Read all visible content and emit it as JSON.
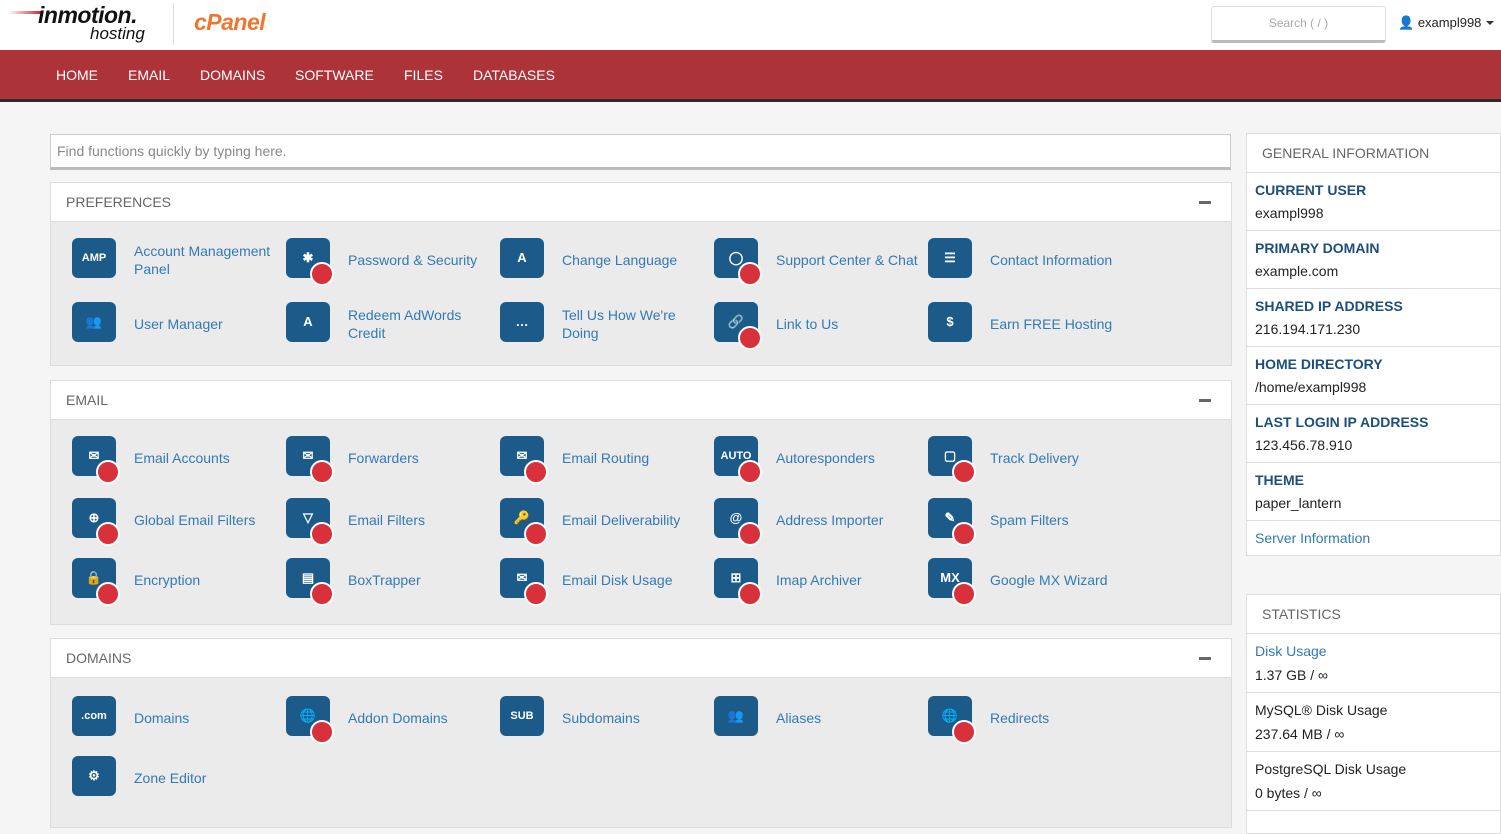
{
  "header": {
    "logo_text": "inmotion hosting",
    "logo_sub": "hosting",
    "product": "cPanel",
    "search_placeholder": "Search ( / )",
    "username": "exampl998"
  },
  "nav": [
    "HOME",
    "EMAIL",
    "DOMAINS",
    "SOFTWARE",
    "FILES",
    "DATABASES"
  ],
  "find_placeholder": "Find functions quickly by typing here.",
  "sections": [
    {
      "title": "PREFERENCES",
      "items": [
        {
          "label": "Account Management Panel",
          "icon": "amp-icon",
          "glyph": "AMP"
        },
        {
          "label": "Password & Security",
          "icon": "shield-password-icon",
          "glyph": "✱"
        },
        {
          "label": "Change Language",
          "icon": "language-icon",
          "glyph": "A"
        },
        {
          "label": "Support Center & Chat",
          "icon": "support-lifebuoy-icon",
          "glyph": "◯"
        },
        {
          "label": "Contact Information",
          "icon": "contact-card-icon",
          "glyph": "☰"
        },
        {
          "label": "User Manager",
          "icon": "user-manager-icon",
          "glyph": "👥"
        },
        {
          "label": "Redeem AdWords Credit",
          "icon": "adwords-icon",
          "glyph": "A"
        },
        {
          "label": "Tell Us How We're Doing",
          "icon": "feedback-icon",
          "glyph": "…"
        },
        {
          "label": "Link to Us",
          "icon": "link-icon",
          "glyph": "🔗"
        },
        {
          "label": "Earn FREE Hosting",
          "icon": "earn-hosting-icon",
          "glyph": "$"
        }
      ]
    },
    {
      "title": "EMAIL",
      "items": [
        {
          "label": "Email Accounts",
          "icon": "email-accounts-icon",
          "glyph": "✉"
        },
        {
          "label": "Forwarders",
          "icon": "forwarders-icon",
          "glyph": "✉"
        },
        {
          "label": "Email Routing",
          "icon": "email-routing-icon",
          "glyph": "✉"
        },
        {
          "label": "Autoresponders",
          "icon": "autoresponders-icon",
          "glyph": "AUTO"
        },
        {
          "label": "Track Delivery",
          "icon": "track-delivery-icon",
          "glyph": "▢"
        },
        {
          "label": "Global Email Filters",
          "icon": "global-filter-icon",
          "glyph": "⊕"
        },
        {
          "label": "Email Filters",
          "icon": "email-filter-icon",
          "glyph": "▽"
        },
        {
          "label": "Email Deliverability",
          "icon": "deliverability-icon",
          "glyph": "🔑"
        },
        {
          "label": "Address Importer",
          "icon": "address-importer-icon",
          "glyph": "@"
        },
        {
          "label": "Spam Filters",
          "icon": "spam-filter-icon",
          "glyph": "✎"
        },
        {
          "label": "Encryption",
          "icon": "encryption-lock-icon",
          "glyph": "🔒"
        },
        {
          "label": "BoxTrapper",
          "icon": "boxtrapper-icon",
          "glyph": "▤"
        },
        {
          "label": "Email Disk Usage",
          "icon": "email-disk-usage-icon",
          "glyph": "✉"
        },
        {
          "label": "Imap Archiver",
          "icon": "imap-archiver-icon",
          "glyph": "⊞"
        },
        {
          "label": "Google MX Wizard",
          "icon": "mx-wizard-icon",
          "glyph": "MX"
        }
      ]
    },
    {
      "title": "DOMAINS",
      "items": [
        {
          "label": "Domains",
          "icon": "domains-icon",
          "glyph": ".com"
        },
        {
          "label": "Addon Domains",
          "icon": "addon-domains-icon",
          "glyph": "🌐"
        },
        {
          "label": "Subdomains",
          "icon": "subdomains-icon",
          "glyph": "SUB"
        },
        {
          "label": "Aliases",
          "icon": "aliases-icon",
          "glyph": "👥"
        },
        {
          "label": "Redirects",
          "icon": "redirects-icon",
          "glyph": "🌐"
        },
        {
          "label": "Zone Editor",
          "icon": "zone-editor-icon",
          "glyph": "⚙"
        }
      ]
    }
  ],
  "general": {
    "title": "GENERAL INFORMATION",
    "rows": [
      {
        "k": "CURRENT USER",
        "v": "exampl998"
      },
      {
        "k": "PRIMARY DOMAIN",
        "v": "example.com"
      },
      {
        "k": "SHARED IP ADDRESS",
        "v": "216.194.171.230"
      },
      {
        "k": "HOME DIRECTORY",
        "v": "/home/exampl998"
      },
      {
        "k": "LAST LOGIN IP ADDRESS",
        "v": "123.456.78.910"
      },
      {
        "k": "THEME",
        "v": "paper_lantern"
      }
    ],
    "link": "Server Information"
  },
  "stats": {
    "title": "STATISTICS",
    "rows": [
      {
        "k": "Disk Usage",
        "v": "1.37 GB / ∞",
        "link": true
      },
      {
        "k": "MySQL® Disk Usage",
        "v": "237.64 MB / ∞"
      },
      {
        "k": "PostgreSQL Disk Usage",
        "v": "0 bytes / ∞"
      }
    ]
  },
  "colors": {
    "nav": "#ac3338",
    "link": "#337ab7",
    "icon_blue": "#1c5b89",
    "icon_red": "#d8313c"
  }
}
